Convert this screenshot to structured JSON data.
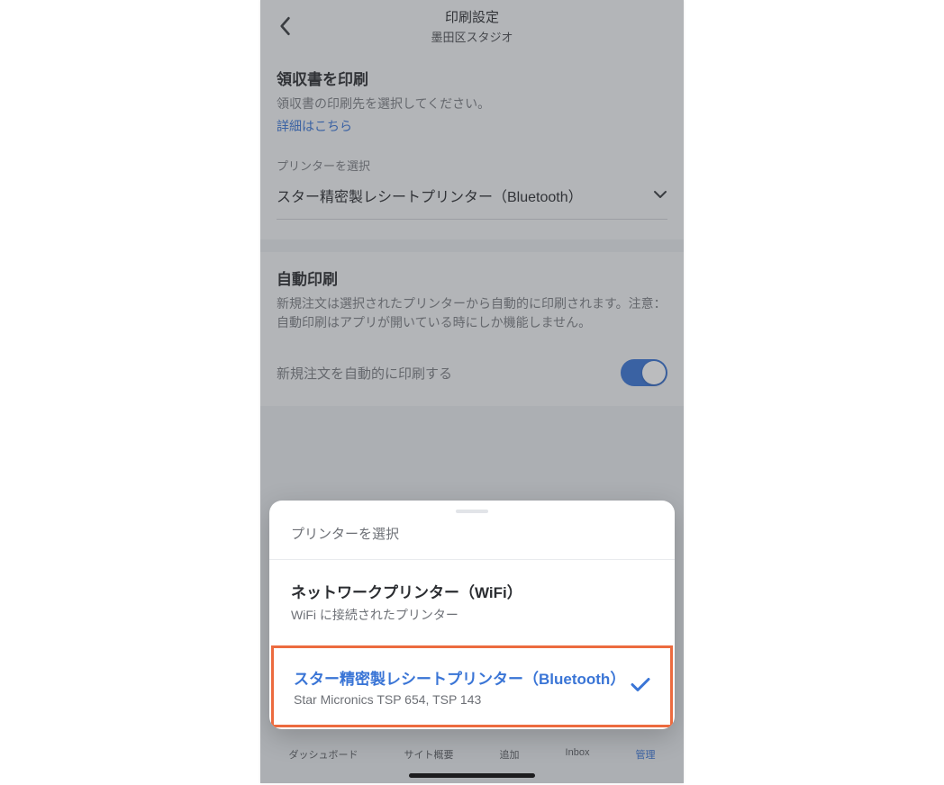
{
  "header": {
    "title": "印刷設定",
    "subtitle": "墨田区スタジオ"
  },
  "receipt": {
    "title": "領収書を印刷",
    "desc": "領収書の印刷先を選択してください。",
    "link": "詳細はこちら",
    "selector_label": "プリンターを選択",
    "selector_value": "スター精密製レシートプリンター（Bluetooth）"
  },
  "auto": {
    "title": "自動印刷",
    "desc": "新規注文は選択されたプリンターから自動的に印刷されます。注意：自動印刷はアプリが開いている時にしか機能しません。",
    "toggle_label": "新規注文を自動的に印刷する"
  },
  "sheet": {
    "title": "プリンターを選択",
    "options": [
      {
        "title": "ネットワークプリンター（WiFi）",
        "sub": "WiFi に接続されたプリンター"
      },
      {
        "title": "スター精密製レシートプリンター（Bluetooth）",
        "sub": "Star Micronics TSP 654, TSP 143"
      }
    ]
  },
  "tabs": {
    "items": [
      "ダッシュボード",
      "サイト概要",
      "追加",
      "Inbox",
      "管理"
    ]
  }
}
